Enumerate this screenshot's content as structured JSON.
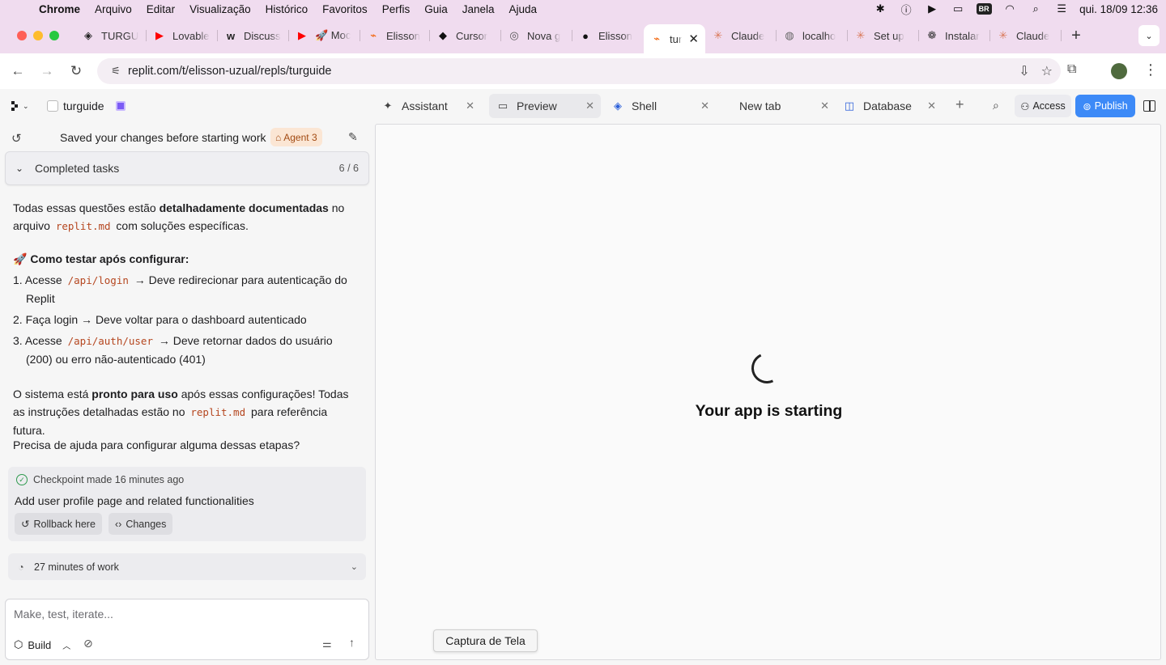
{
  "menubar": {
    "app": "Chrome",
    "items": [
      "Arquivo",
      "Editar",
      "Visualização",
      "Histórico",
      "Favoritos",
      "Perfis",
      "Guia",
      "Janela",
      "Ajuda"
    ],
    "kb_badge": "BR",
    "clock": "qui. 18/09  12:36"
  },
  "browser": {
    "tabs": [
      {
        "title": "TURGU",
        "icon": "turgu-icon",
        "color": "#222222",
        "glyph": "◈"
      },
      {
        "title": "Lovable",
        "icon": "youtube-icon",
        "color": "#ff0000",
        "glyph": "▶"
      },
      {
        "title": "Discuss",
        "icon": "discuss-icon",
        "color": "#222222",
        "glyph": "w"
      },
      {
        "title": "🚀 Moc",
        "icon": "youtube-icon",
        "color": "#ff0000",
        "glyph": "▶"
      },
      {
        "title": "Elisson",
        "icon": "replit-icon",
        "color": "#f26207",
        "glyph": "⌁"
      },
      {
        "title": "Cursor",
        "icon": "cursor-icon",
        "color": "#111111",
        "glyph": "◆"
      },
      {
        "title": "Nova g",
        "icon": "chrome-icon",
        "color": "#555555",
        "glyph": "◎"
      },
      {
        "title": "Elisson",
        "icon": "github-icon",
        "color": "#111111",
        "glyph": "●"
      },
      {
        "title": "turg",
        "icon": "replit-icon",
        "color": "#f26207",
        "glyph": "⌁",
        "active": true
      },
      {
        "title": "Claude",
        "icon": "claude-icon",
        "color": "#d97757",
        "glyph": "✳"
      },
      {
        "title": "localho",
        "icon": "globe-icon",
        "color": "#666666",
        "glyph": "◍"
      },
      {
        "title": "Set up",
        "icon": "claude-icon",
        "color": "#d97757",
        "glyph": "✳"
      },
      {
        "title": "Instalar",
        "icon": "openai-icon",
        "color": "#333333",
        "glyph": "❁"
      },
      {
        "title": "Claude",
        "icon": "claude-icon",
        "color": "#d97757",
        "glyph": "✳"
      }
    ],
    "url": "replit.com/t/elisson-uzual/repls/turguide"
  },
  "workspace": {
    "repl_name": "turguide",
    "tabs": [
      {
        "label": "Assistant",
        "icon": "✦",
        "active": false
      },
      {
        "label": "Preview",
        "icon": "▭",
        "active": true
      },
      {
        "label": "Shell",
        "icon": "◈",
        "active": false
      },
      {
        "label": "New tab",
        "icon": "",
        "active": false
      },
      {
        "label": "Database",
        "icon": "◫",
        "active": false
      }
    ],
    "access_label": "Access",
    "publish_label": "Publish",
    "publish_color": "#3d8af7"
  },
  "agent": {
    "status": "Saved your changes before starting work",
    "badge": "Agent 3",
    "completed_label": "Completed tasks",
    "completed_count": "6 / 6",
    "message": {
      "p1_a": "Todas essas questões estão ",
      "p1_b": "detalhadamente documentadas",
      "p1_c": " no arquivo ",
      "p1_code": "replit.md",
      "p1_d": " com soluções específicas.",
      "h_emoji": "🚀",
      "h_text": "Como testar após configurar:",
      "steps": [
        {
          "n": "1.",
          "pre": "Acesse ",
          "code": "/api/login",
          "post": " → Deve redirecionar para autenticação do Replit"
        },
        {
          "n": "2.",
          "pre": "Faça login → Deve voltar para o dashboard autenticado",
          "code": "",
          "post": ""
        },
        {
          "n": "3.",
          "pre": "Acesse ",
          "code": "/api/auth/user",
          "post": " → Deve retornar dados do usuário (200) ou erro não-autenticado (401)"
        }
      ],
      "p2_a": "O sistema está ",
      "p2_b": "pronto para uso",
      "p2_c": " após essas configurações! Todas as instruções detalhadas estão no ",
      "p2_code": "replit.md",
      "p2_d": " para referência futura.",
      "p3": "Precisa de ajuda para configurar alguma dessas etapas?"
    },
    "checkpoint": {
      "meta": "Checkpoint made 16 minutes ago",
      "title": "Add user profile page and related functionalities",
      "rollback": "Rollback here",
      "changes": "Changes"
    },
    "work_time": "27 minutes of work",
    "composer_placeholder": "Make, test, iterate...",
    "mode": "Build"
  },
  "preview": {
    "status": "Your app is starting"
  },
  "tooltip": "Captura de Tela"
}
